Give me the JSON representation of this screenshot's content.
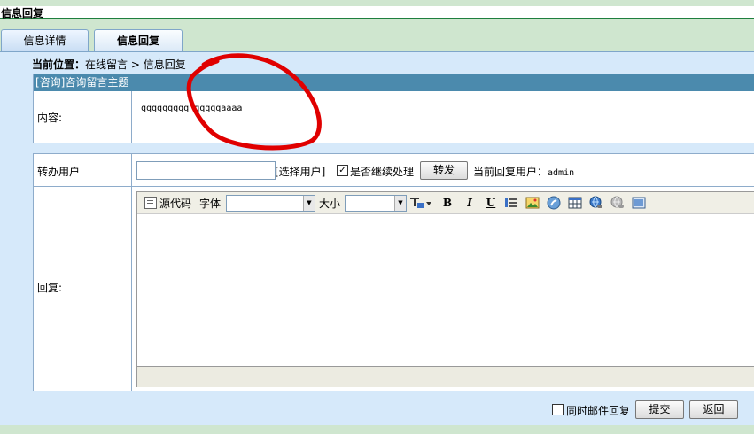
{
  "page": {
    "title": "信息回复"
  },
  "tabs": [
    {
      "label": "信息详情"
    },
    {
      "label": "信息回复"
    }
  ],
  "breadcrumb": {
    "prefix": "当前位置：",
    "path": "在线留言 > 信息回复"
  },
  "message": {
    "subject": "[咨询]咨询留言主题",
    "content_label": "内容:",
    "content": "qqqqqqqqq qqqqqaaaa"
  },
  "forward": {
    "label": "转办用户",
    "user_value": "",
    "select_user": "[选择用户]",
    "continue_label": "是否继续处理",
    "continue_checked": true,
    "forward_button": "转发",
    "current_user_label": "当前回复用户：",
    "current_user": "admin"
  },
  "reply": {
    "label": "回复:",
    "editor": {
      "source_label": "源代码",
      "font_label": "字体",
      "font_value": "",
      "size_label": "大小",
      "size_value": "",
      "icons": [
        "text-color-icon",
        "bold-icon",
        "italic-icon",
        "underline-icon",
        "horizontal-rule-icon",
        "image-icon",
        "flash-icon",
        "table-icon",
        "link-icon",
        "unlink-icon",
        "fullscreen-icon"
      ]
    }
  },
  "footer": {
    "mail_label": "同时邮件回复",
    "mail_checked": false,
    "submit_button": "提交",
    "back_button": "返回"
  },
  "colors": {
    "subject_bar": "#4b8aad",
    "panel": "#d6e9fa",
    "annotation": "#e00000"
  }
}
